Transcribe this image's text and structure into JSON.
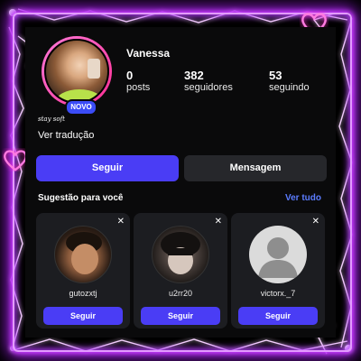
{
  "profile": {
    "username": "Vanessa",
    "badge": "NOVO",
    "bio_script": "stay soft",
    "translate_label": "Ver tradução",
    "stats": [
      {
        "value": "0",
        "label": "posts"
      },
      {
        "value": "382",
        "label": "seguidores"
      },
      {
        "value": "53",
        "label": "seguindo"
      }
    ]
  },
  "actions": {
    "follow_label": "Seguir",
    "message_label": "Mensagem"
  },
  "suggestions": {
    "title": "Sugestão para você",
    "see_all": "Ver tudo",
    "cards": [
      {
        "name": "gutozxtj",
        "button": "Seguir",
        "close": "✕"
      },
      {
        "name": "u2rr20",
        "button": "Seguir",
        "close": "✕"
      },
      {
        "name": "victorx._7",
        "button": "Seguir",
        "close": "✕"
      }
    ]
  },
  "colors": {
    "accent": "#4a3df5",
    "link": "#5b7cff",
    "frame_glow": "#c83cff",
    "new_badge": "#3b4cf7"
  }
}
